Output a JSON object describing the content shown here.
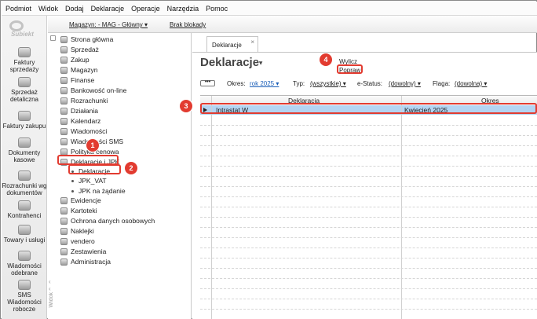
{
  "menu": [
    "Podmiot",
    "Widok",
    "Dodaj",
    "Deklaracje",
    "Operacje",
    "Narzędzia",
    "Pomoc"
  ],
  "logo": "Subiekt",
  "leftbar": [
    {
      "label": "Faktury sprzedaży",
      "icon": "invoice-icon"
    },
    {
      "label": "Sprzedaż detaliczna",
      "icon": "retail-icon"
    },
    {
      "label": "Faktury zakupu",
      "icon": "purchase-invoice-icon"
    },
    {
      "label": "Dokumenty kasowe",
      "icon": "cash-documents-icon"
    },
    {
      "label": "Rozrachunki wg dokumentów",
      "icon": "settlements-icon"
    },
    {
      "label": "Kontrahenci",
      "icon": "contractors-icon"
    },
    {
      "label": "Towary i usługi",
      "icon": "goods-icon"
    },
    {
      "label": "Wiadomości odebrane",
      "icon": "messages-icon"
    },
    {
      "label": "SMS Wiadomości robocze",
      "icon": "sms-icon"
    }
  ],
  "toolbar": {
    "warehouse": "Magazyn: - MAG - Główny ▾",
    "lock": "Brak blokady"
  },
  "tree": [
    "Strona główna",
    "Sprzedaż",
    "Zakup",
    "Magazyn",
    "Finanse",
    "Bankowość on-line",
    "Rozrachunki",
    "Działania",
    "Kalendarz",
    "Wiadomości",
    "Wiadomości SMS",
    "Polityka cenowa",
    "Deklaracje i JPK",
    "Deklaracje",
    "JPK_VAT",
    "JPK na żądanie",
    "Ewidencje",
    "Kartoteki",
    "Ochrona danych osobowych",
    "Naklejki",
    "vendero",
    "Zestawienia",
    "Administracja"
  ],
  "tree_side_label": "Widok",
  "tab": {
    "label": "Deklaracje",
    "close": "×"
  },
  "title": "Deklaracje",
  "actions": {
    "compute": "Wylicz",
    "fix": "Popraw"
  },
  "filters": {
    "more": "•••",
    "period_label": "Okres:",
    "period_value": "rok 2025 ▾",
    "type_label": "Typ:",
    "type_value": "(wszystkie) ▾",
    "estatus_label": "e-Status:",
    "estatus_value": "(dowolny) ▾",
    "flag_label": "Flaga:",
    "flag_value": "(dowolna) ▾"
  },
  "grid": {
    "headers": [
      "Deklaracja",
      "Okres"
    ],
    "rows": [
      {
        "declaration": "Intrastat W",
        "period": "Kwiecień 2025"
      }
    ]
  },
  "annotations": [
    "1",
    "2",
    "3",
    "4"
  ],
  "colors": {
    "annotation": "#e23b30",
    "selection": "#b3d4f2",
    "link": "#1b5fb8"
  }
}
